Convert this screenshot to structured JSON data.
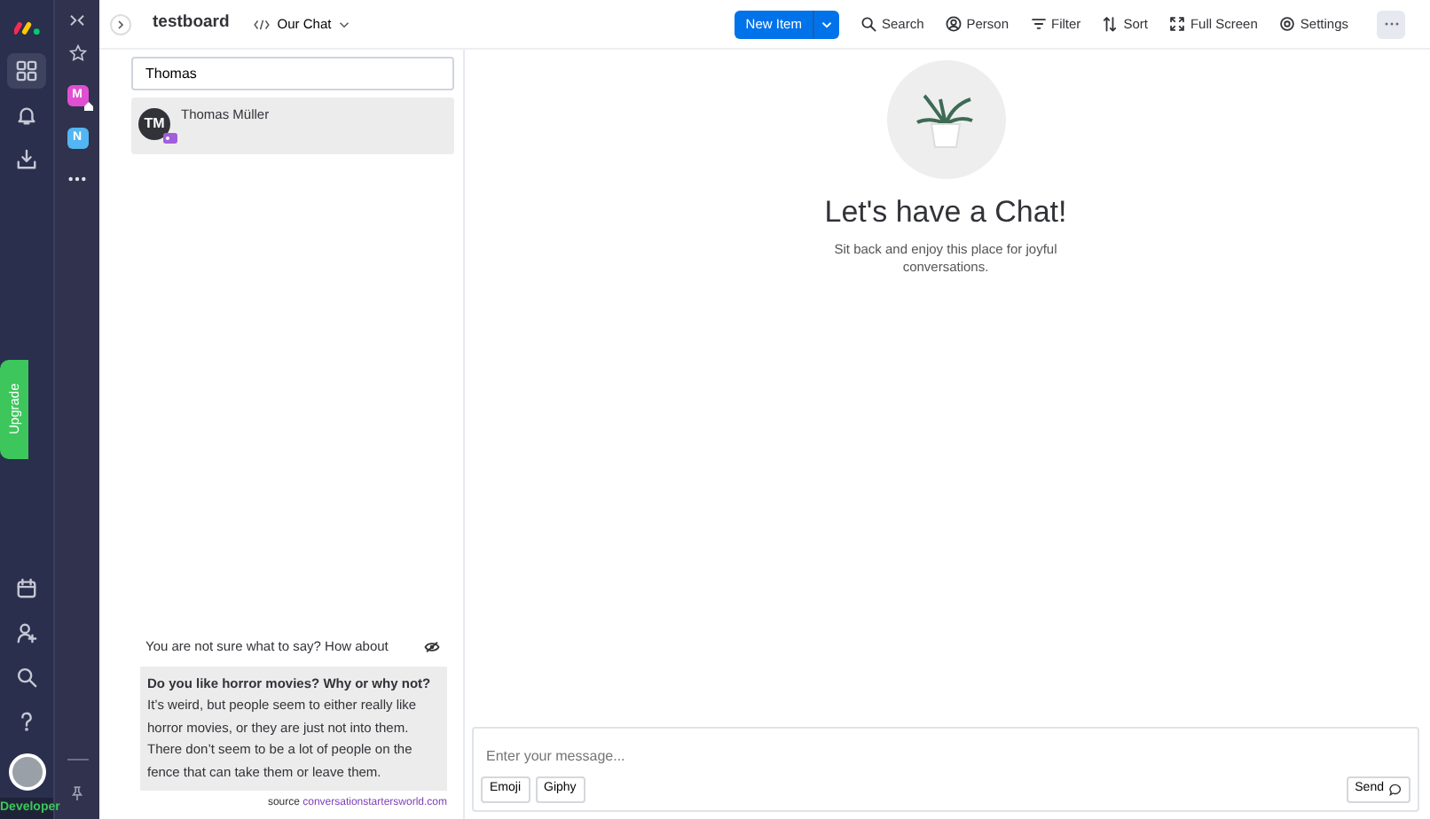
{
  "left_rail": {
    "upgrade": "Upgrade",
    "developer_label": "Developer",
    "top_items": [
      {
        "kind": "grid",
        "selected": true
      },
      {
        "kind": "bell",
        "selected": false
      },
      {
        "kind": "inbox",
        "selected": false
      }
    ],
    "bottom_items": [
      {
        "kind": "calendar"
      },
      {
        "kind": "person-add"
      },
      {
        "kind": "search"
      },
      {
        "kind": "help"
      }
    ]
  },
  "workspace_rail": {
    "workspaces": [
      {
        "letter": "M",
        "color": "#e04fd1",
        "home": true
      },
      {
        "letter": "N",
        "color": "#53b6f2",
        "home": false
      }
    ]
  },
  "header": {
    "board_title": "testboard",
    "view": "Our Chat",
    "new_item": "New Item"
  },
  "toolbar": [
    {
      "kind": "search",
      "label": "Search"
    },
    {
      "kind": "person",
      "label": "Person"
    },
    {
      "kind": "filter",
      "label": "Filter"
    },
    {
      "kind": "sort",
      "label": "Sort"
    },
    {
      "kind": "fullscreen",
      "label": "Full Screen"
    },
    {
      "kind": "settings",
      "label": "Settings"
    }
  ],
  "people_search": {
    "value": "Thomas"
  },
  "people": [
    {
      "initials": "TM",
      "name": "Thomas Müller",
      "selected": true
    }
  ],
  "suggestion": {
    "prompt": "You are not sure what to say? How about",
    "text": "**Do you like horror movies? Why or why not?** It’s weird, but people seem to either really like horror movies, or they are just not into them. There don’t seem to be a lot of people on the fence that can take them or leave them.",
    "source_label": "source",
    "source_link": "conversationstartersworld.com"
  },
  "chat": {
    "title": "Let's have a Chat!",
    "subtitle": "Sit back and enjoy this place for joyful conversations.",
    "placeholder": "Enter your message...",
    "buttons": [
      "Emoji",
      "Giphy"
    ],
    "send": "Send"
  }
}
